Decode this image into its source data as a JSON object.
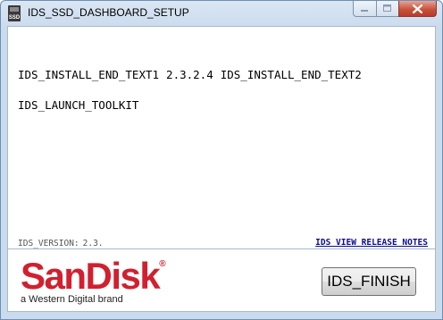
{
  "window": {
    "title": "IDS_SSD_DASHBOARD_SETUP",
    "icon_label": "SSD",
    "icon": "ssd-drive-icon"
  },
  "content": {
    "install_end_text1": "IDS_INSTALL_END_TEXT1",
    "version_number": "2.3.2.4",
    "install_end_text2": "IDS_INSTALL_END_TEXT2",
    "launch_toolkit": "IDS_LAUNCH_TOOLKIT",
    "version_label": "IDS_VERSION:",
    "version_value": "2.3.",
    "release_notes_link": "IDS VIEW RELEASE NOTES"
  },
  "footer": {
    "brand": "SanDisk",
    "brand_mark": "®",
    "tagline": "a Western Digital brand",
    "finish_label": "IDS_FINISH"
  },
  "colors": {
    "brand_red": "#d1202f",
    "link": "#0c0c8c",
    "title_bar": "#cbdbee",
    "close_button": "#c9533c"
  }
}
